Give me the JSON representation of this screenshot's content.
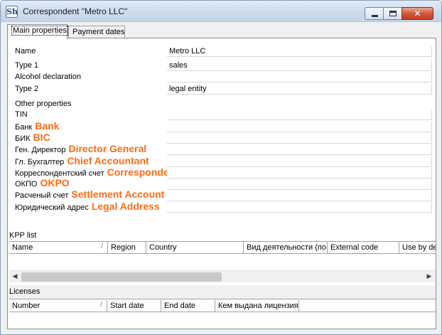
{
  "window": {
    "icon_text": "Sh",
    "title": "Correspondent \"Metro LLC\"",
    "close_glyph": "✕"
  },
  "tabs": [
    {
      "label": "Main properties",
      "active": true
    },
    {
      "label": "Payment dates",
      "active": false
    }
  ],
  "properties": {
    "name": {
      "label": "Name",
      "value": "Metro LLC"
    },
    "type1": {
      "label": "Type 1",
      "value": "sales"
    },
    "alcohol": {
      "label": "Alcohol declaration",
      "value": ""
    },
    "type2": {
      "label": "Type 2",
      "value": "legal entity"
    }
  },
  "other_properties": {
    "section_label": "Other properties",
    "tin": {
      "label": "TIN",
      "value": ""
    },
    "bank": {
      "label": "Банк",
      "translation": "Bank",
      "value": ""
    },
    "bic": {
      "label": "БИК",
      "translation": "BIC",
      "value": ""
    },
    "director": {
      "label": "Ген. Директор",
      "translation": "Director General",
      "value": ""
    },
    "accountant": {
      "label": "Гл. Бухгалтер",
      "translation": "Chief Accountant",
      "value": ""
    },
    "corr_account": {
      "label": "Корреспондентский счет",
      "translation": "Correspondent Account",
      "value": ""
    },
    "okpo": {
      "label": "ОКПО",
      "translation": "OKPO",
      "value": ""
    },
    "settlement": {
      "label": "Расченый счет",
      "translation": "Settlement Account",
      "value": ""
    },
    "legal_address": {
      "label": "Юридический адрес",
      "translation": "Legal Address",
      "value": ""
    }
  },
  "kpp_list": {
    "section_label": "KPP list",
    "columns": [
      "Name",
      "Region",
      "Country",
      "Вид деятельности (по",
      "External code",
      "Use by de"
    ],
    "sort_glyph": "/",
    "scroll_left": "◀",
    "scroll_right": "▶"
  },
  "licenses": {
    "section_label": "Licenses",
    "columns": [
      "Number",
      "Start date",
      "End date",
      "Кем выдана лицензия"
    ],
    "sort_glyph": "/"
  }
}
